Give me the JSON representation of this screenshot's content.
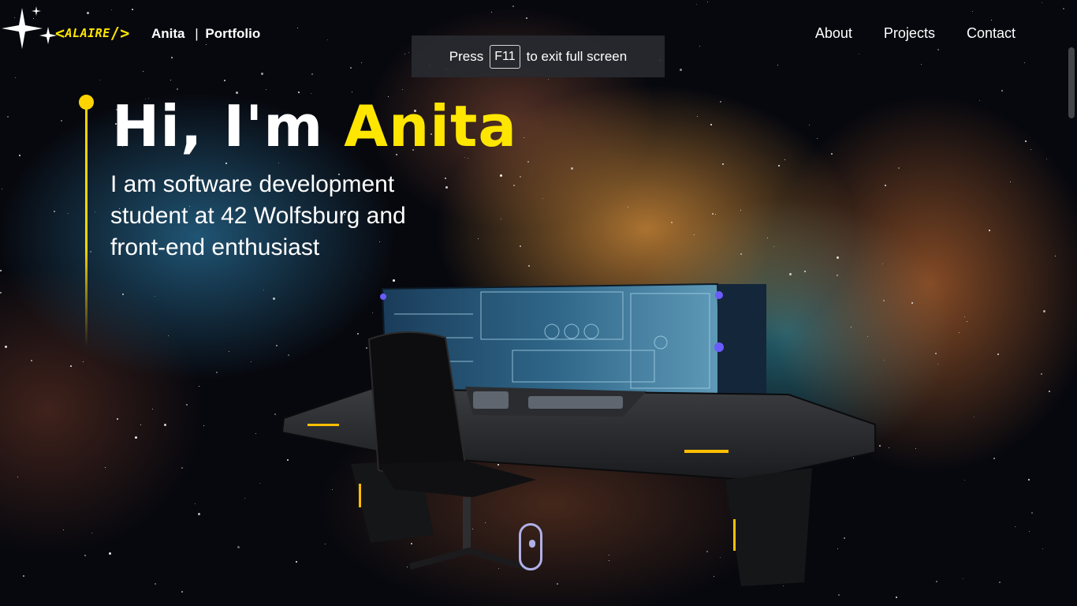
{
  "brand": {
    "logo_text": "ALAIRE",
    "logo_open": "<",
    "logo_close": "/>",
    "name": "Anita",
    "separator": "|",
    "subtitle": "Portfolio"
  },
  "nav": {
    "items": [
      {
        "label": "About"
      },
      {
        "label": "Projects"
      },
      {
        "label": "Contact"
      }
    ]
  },
  "fullscreen_tip": {
    "prefix": "Press",
    "key": "F11",
    "suffix": "to exit full screen"
  },
  "hero": {
    "greeting": "Hi, I'm",
    "name": "Anita",
    "description": "I am software development student at 42 Wolfsburg and front-end enthusiast"
  },
  "colors": {
    "accent": "#ffe600",
    "text": "#ffffff",
    "scroll_indicator": "#b0b0e8"
  },
  "icons": {
    "sparkle": "sparkle-icon",
    "scroll": "scroll-mouse-icon"
  }
}
